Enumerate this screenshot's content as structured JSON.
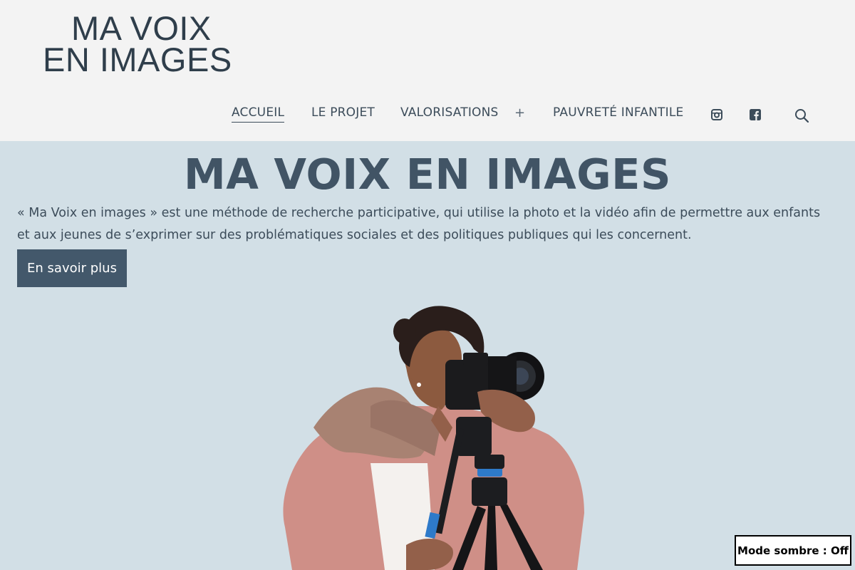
{
  "logo": {
    "line1": "MA VOIX",
    "line2": "EN IMAGES"
  },
  "nav": {
    "items": [
      {
        "label": "ACCUEIL",
        "active": true
      },
      {
        "label": "LE PROJET",
        "active": false
      },
      {
        "label": "VALORISATIONS",
        "active": false
      },
      {
        "label": "PAUVRETÉ INFANTILE",
        "active": false
      }
    ],
    "submenu_toggle": "+",
    "icons": [
      "instagram-icon",
      "facebook-icon",
      "search-icon"
    ]
  },
  "hero": {
    "title": "MA VOIX EN IMAGES",
    "description": "« Ma Voix en images » est une méthode de recherche participative, qui utilise la photo et la vidéo afin de permettre aux enfants et aux jeunes de s’exprimer sur des problématiques sociales et des politiques publiques qui les concernent.",
    "cta": "En savoir plus"
  },
  "dark_mode": {
    "label": "Mode sombre : Off"
  },
  "colors": {
    "header_bg": "#f3f3f3",
    "page_bg": "#d2dfe6",
    "text": "#3c4c5a",
    "button_bg": "#43586b"
  }
}
